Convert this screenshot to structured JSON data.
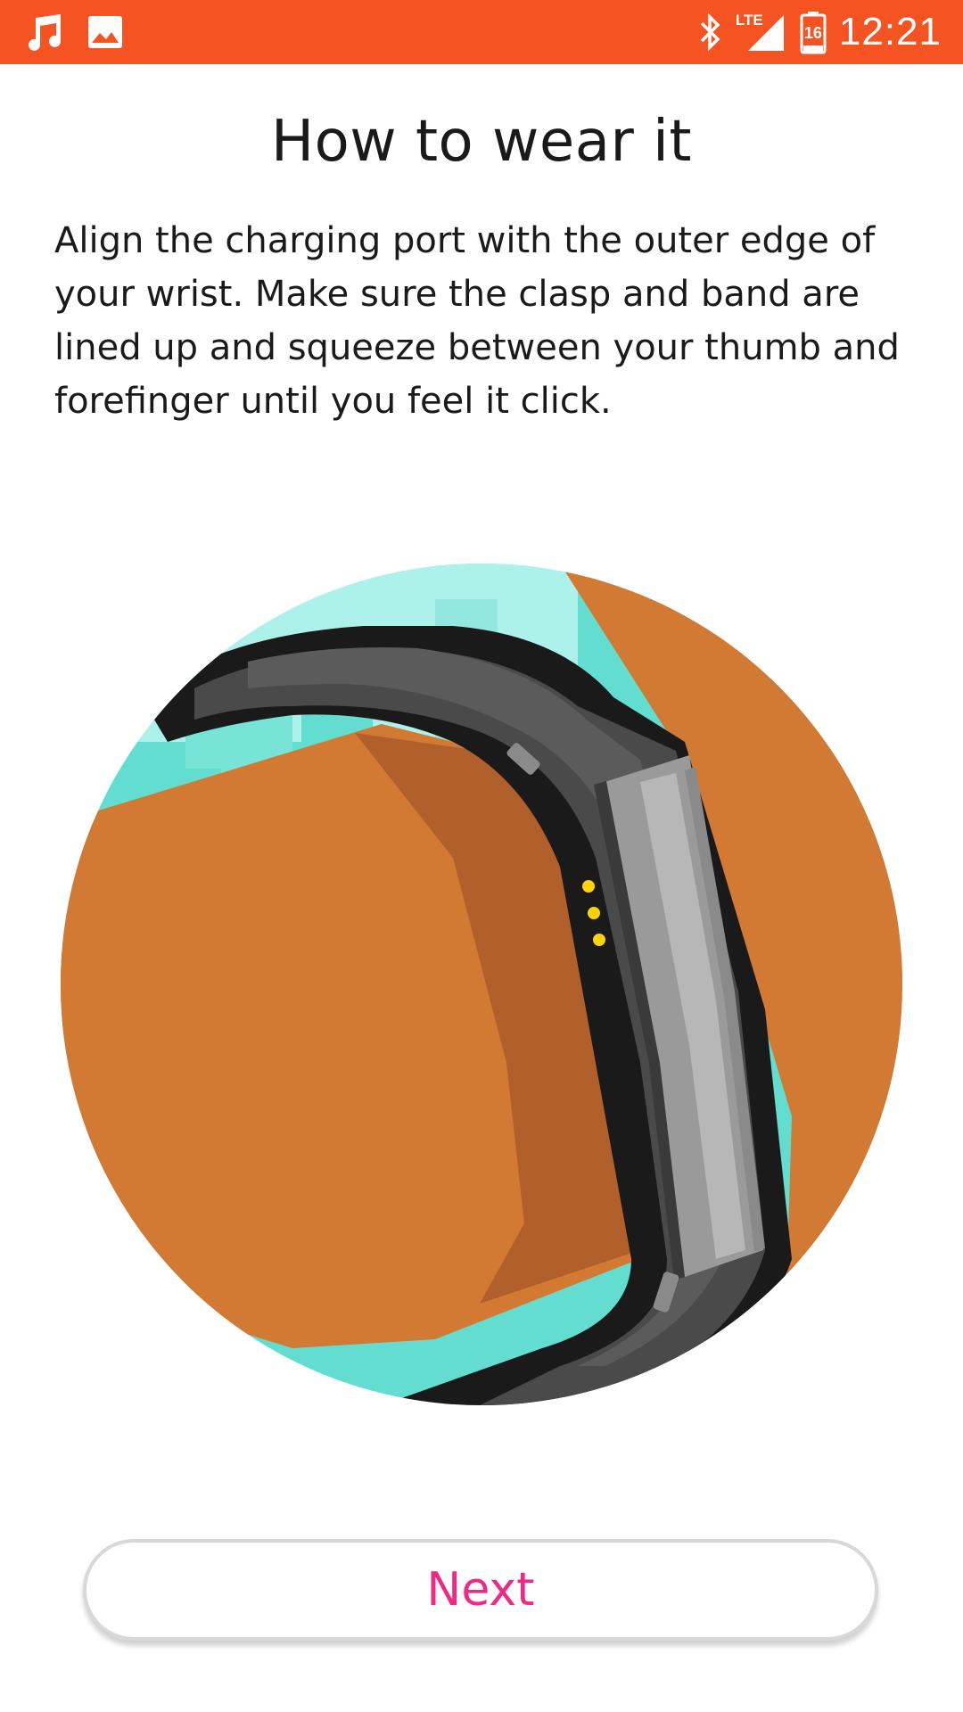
{
  "status_bar": {
    "left_icons": [
      "music-note-icon",
      "image-icon"
    ],
    "right_icons": [
      "bluetooth-icon",
      "lte-signal-icon",
      "battery-icon"
    ],
    "network_label": "LTE",
    "battery_level": "16",
    "time": "12:21",
    "background_color": "#f55322"
  },
  "page": {
    "title": "How to wear it",
    "description": "Align the charging port with the outer edge of your wrist. Make sure the clasp and band are lined up and squeeze between your thumb and forefinger until you feel it click.",
    "illustration_icon": "fitness-band-on-wrist-illustration"
  },
  "actions": {
    "next_label": "Next",
    "accent_color": "#ee2a83"
  }
}
